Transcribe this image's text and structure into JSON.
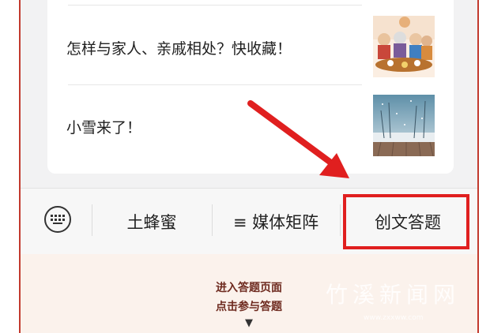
{
  "articles": [
    {
      "title": "怎样与家人、亲戚相处？快收藏！",
      "thumb_icon": "family-dinner-illustration"
    },
    {
      "title": "小雪来了！",
      "thumb_icon": "snowy-landscape-illustration"
    }
  ],
  "menu": {
    "keyboard_icon": "keyboard-icon",
    "items": [
      "土蜂蜜",
      "≡ 媒体矩阵",
      "创文答题"
    ]
  },
  "cta": {
    "line1": "进入答题页面",
    "line2": "点击参与答题",
    "arrow": "▼"
  },
  "watermark": {
    "main": "竹溪新闻网",
    "url": "www.zxxww.com"
  },
  "colors": {
    "frame_border": "#c23a2e",
    "highlight": "#e01f1f",
    "annotation_arrow": "#e01f1f",
    "cta_text": "#6e2a1f",
    "bottom_bg": "#fbf2ec"
  }
}
